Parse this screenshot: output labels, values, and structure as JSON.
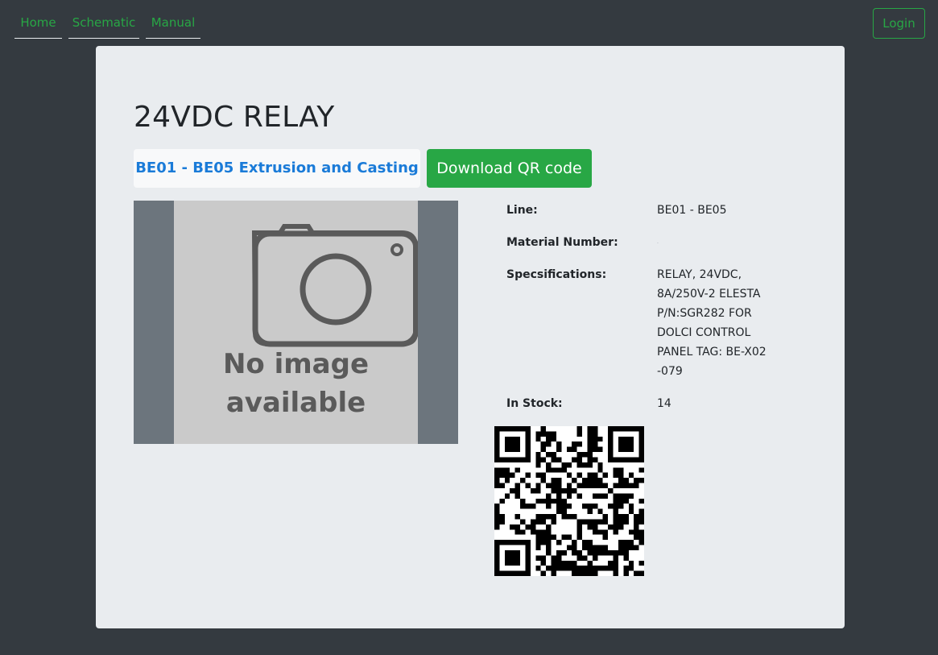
{
  "nav": {
    "home": "Home",
    "schematic": "Schematic",
    "manual": "Manual",
    "login": "Login"
  },
  "item": {
    "title": "24VDC RELAY",
    "line_badge": "BE01 - BE05 Extrusion and Casting",
    "download_label": "Download QR code",
    "placeholder_line1": "No image",
    "placeholder_line2": "available"
  },
  "specs": {
    "line_label": "Line:",
    "line_value": "BE01 - BE05",
    "material_label": "Material Number:",
    "material_value": ".",
    "spec_label": "Specsifications:",
    "spec_value": "RELAY, 24VDC, 8A/250V-2 ELESTA P/N:SGR282 FOR DOLCI CONTROL PANEL TAG: BE-X02 -079",
    "stock_label": "In Stock:",
    "stock_value": "14"
  },
  "colors": {
    "page_bg": "#343a40",
    "card_bg": "#e9ecef",
    "accent_green": "#28a745",
    "link_blue": "#1a7bd8"
  }
}
